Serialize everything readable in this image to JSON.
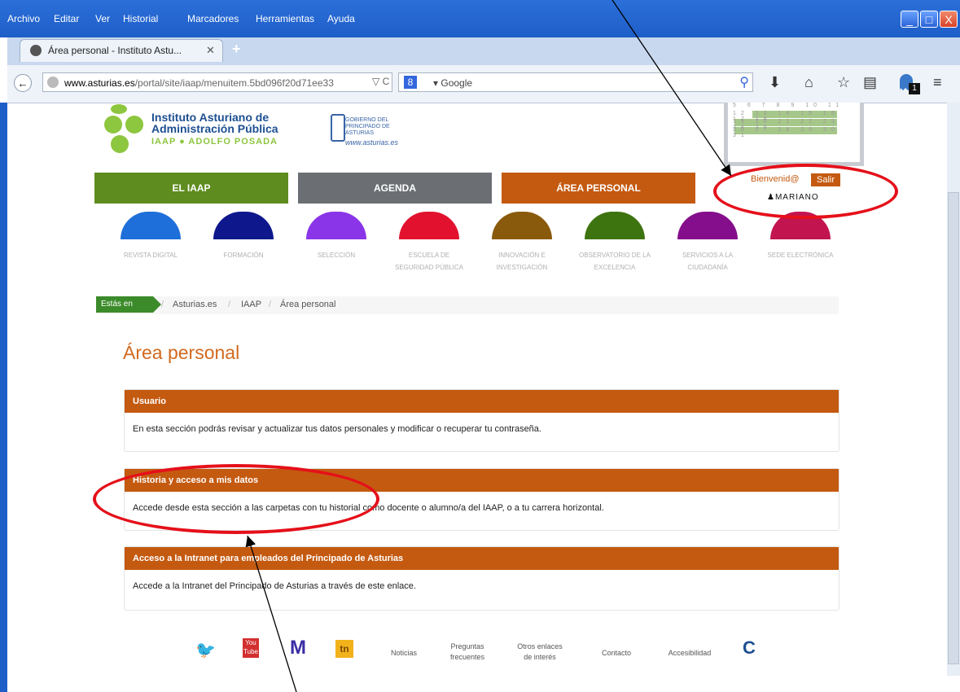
{
  "menubar": {
    "items": [
      "Archivo",
      "Editar",
      "Ver",
      "Historial",
      "Marcadores",
      "Herramientas",
      "Ayuda"
    ],
    "window_buttons": [
      "_",
      "□",
      "X"
    ]
  },
  "tab": {
    "title": "Área personal - Instituto Astu...",
    "close": "✕",
    "new_tab": "+"
  },
  "address_bar": {
    "url_host": "www.asturias.es",
    "url_path": "/portal/site/iaap/menuitem.5bd096f20d71ee33",
    "controls": "▽ C"
  },
  "search_bar": {
    "engine": "8",
    "placeholder": "▾ Google"
  },
  "toolbar_icons": [
    "search-magnifier-icon",
    "download-icon",
    "home-icon",
    "bookmark-star-icon",
    "reading-list-icon",
    "ghostery-icon",
    "hamburger-menu-icon"
  ],
  "ghostery_badge": "1",
  "header": {
    "logo_line1": "Instituto Asturiano de",
    "logo_line2": "Administración Pública",
    "logo_line3": "IAAP ● ADOLFO POSADA",
    "gov_text": "GOBIERNO DEL PRINCIPADO DE ASTURIAS",
    "gov_url": "www.asturias.es",
    "calendar_rows": [
      "5 6 7 8 9 10 11",
      "12 13 14 15 16 17 18",
      "19 20 21 22 23 24 25",
      "26 27 28 29 30 31"
    ]
  },
  "main_nav": [
    {
      "label": "EL IAAP",
      "color": "#5e8c1e"
    },
    {
      "label": "AGENDA",
      "color": "#6b6f73"
    },
    {
      "label": "ÁREA PERSONAL",
      "color": "#c45a10"
    }
  ],
  "session": {
    "welcome": "Bienvenid@",
    "logout": "Salir",
    "user": "MARIANO"
  },
  "services": [
    {
      "label": "REVISTA DIGITAL",
      "color": "#1e6fd9"
    },
    {
      "label": "FORMACIÓN",
      "color": "#0f178c"
    },
    {
      "label": "SELECCIÓN",
      "color": "#8a35e8"
    },
    {
      "label": "ESCUELA DE SEGURIDAD PÚBLICA",
      "color": "#e2122e"
    },
    {
      "label": "INNOVACIÓN E INVESTIGACIÓN",
      "color": "#8a5a0c"
    },
    {
      "label": "OBSERVATORIO DE LA EXCELENCIA",
      "color": "#3e7410"
    },
    {
      "label": "SERVICIOS A LA CIUDADANÍA",
      "color": "#850e8c"
    },
    {
      "label": "SEDE ELECTRÓNICA",
      "color": "#c2144f"
    }
  ],
  "breadcrumb": {
    "prefix": "Estás en",
    "items": [
      "Asturias.es",
      "IAAP",
      "Área personal"
    ],
    "sep": "/"
  },
  "page_title": "Área personal",
  "panels": [
    {
      "title": "Usuario",
      "body": "En esta sección podrás revisar y actualizar tus datos personales y modificar o recuperar tu contraseña."
    },
    {
      "title": "Historia y acceso a mis datos",
      "body": "Accede desde esta sección a las carpetas con tu historial como docente o alumno/a del IAAP, o a tu carrera horizontal."
    },
    {
      "title": "Acceso a la Intranet para empleados del Principado de Asturias",
      "body": "Accede a la Intranet del Principado de Asturias a través de este enlace."
    }
  ],
  "footer": {
    "icons": [
      "twitter-icon",
      "youtube-icon",
      "m-logo-icon",
      "tn-logo-icon"
    ],
    "youtube_text": "You Tube",
    "m_text": "M",
    "tn_text": "tn",
    "links": [
      "Noticias",
      "Preguntas frecuentes",
      "Otros enlaces de interés",
      "Contacto",
      "Accesibilidad"
    ],
    "c_text": "C"
  }
}
